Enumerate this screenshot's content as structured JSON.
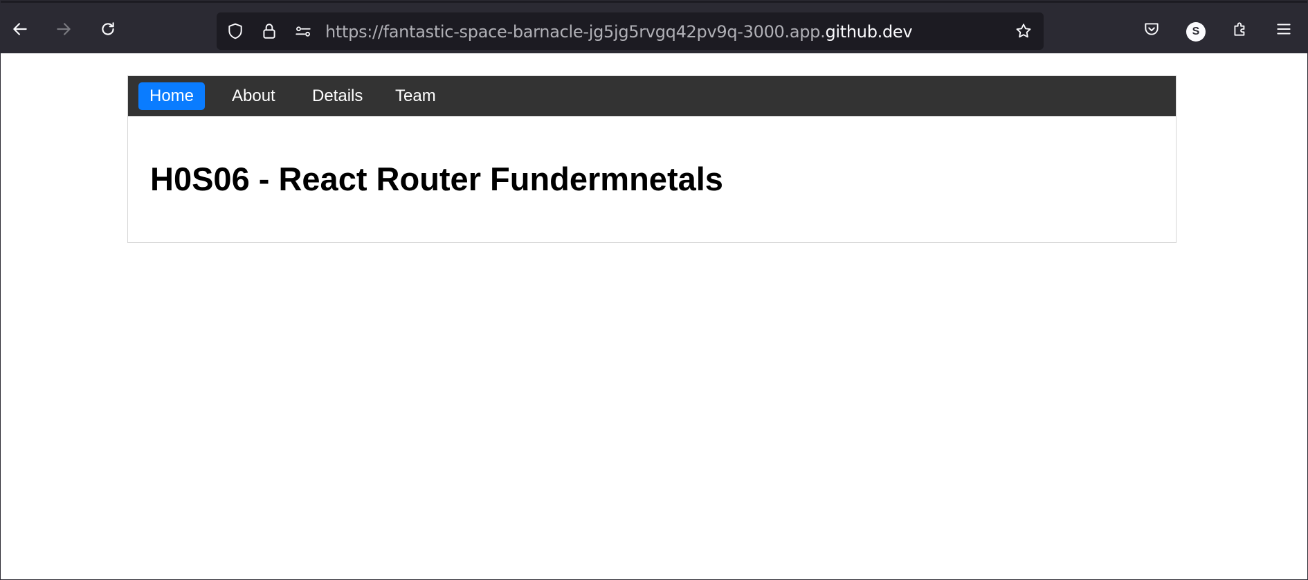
{
  "browser": {
    "url_prefix": "https://fantastic-space-barnacle-jg5jg5rvgq42pv9q-3000.app.",
    "url_domain": "github.dev",
    "profile_initial": "S",
    "icons": [
      "back-arrow-icon",
      "forward-arrow-icon",
      "reload-icon",
      "shield-icon",
      "lock-icon",
      "permissions-icon",
      "bookmark-star-icon",
      "pocket-icon",
      "avatar",
      "extensions-icon",
      "hamburger-menu-icon"
    ],
    "colors": {
      "toolbar": "#2b2a33",
      "urlbar": "#1c1b22"
    }
  },
  "nav": {
    "items": [
      {
        "label": "Home",
        "active": true
      },
      {
        "label": "About",
        "active": false
      },
      {
        "label": "Details",
        "active": false
      },
      {
        "label": "Team",
        "active": false
      }
    ],
    "colors": {
      "background": "#333333",
      "active": "#0a7cff"
    }
  },
  "main": {
    "title": "H0S06 - React Router Fundermnetals"
  }
}
